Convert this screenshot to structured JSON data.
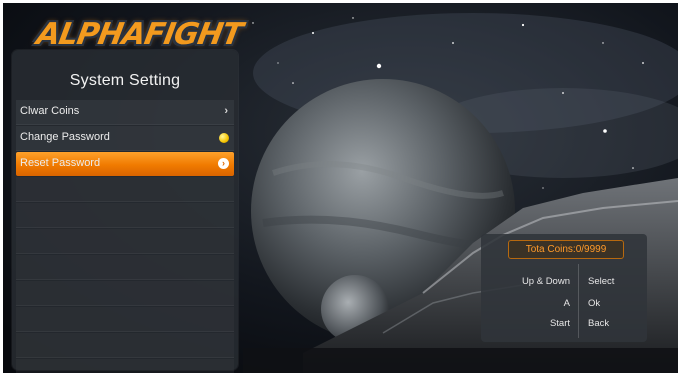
{
  "logo": {
    "text": "ALPHAFIGHT"
  },
  "settings_panel": {
    "title": "System Setting",
    "items": [
      {
        "label": "Clwar Coins",
        "indicator": "chevron-right-icon"
      },
      {
        "label": "Change Password",
        "indicator": "yellow-dot-icon"
      },
      {
        "label": "Reset Password",
        "indicator": "chevron-right-icon",
        "selected": true
      }
    ],
    "empty_rows": 8
  },
  "info_panel": {
    "coins_label": "Tota Coins:0/9999",
    "controls": [
      {
        "key": "Up & Down",
        "action": "Select"
      },
      {
        "key": "A",
        "action": "Ok"
      },
      {
        "key": "Start",
        "action": "Back"
      }
    ]
  },
  "colors": {
    "accent": "#f07a00",
    "coins_text": "#ff9a2a",
    "panel_bg": "#282c32"
  }
}
